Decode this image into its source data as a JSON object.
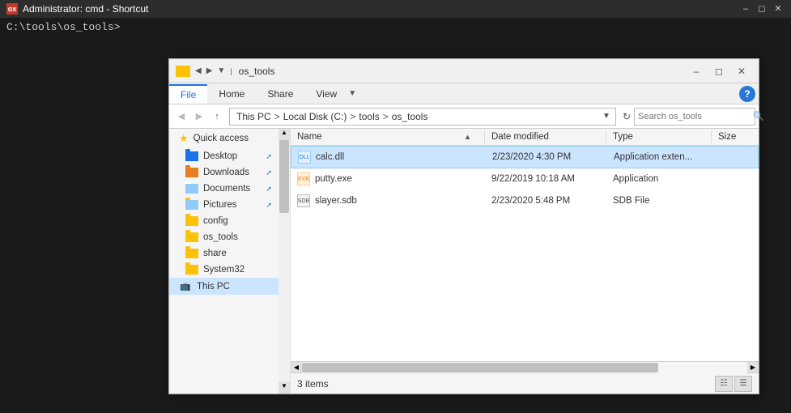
{
  "cmd": {
    "title": "Administrator: cmd - Shortcut",
    "icon_label": "ox",
    "prompt": "C:\\tools\\os_tools>"
  },
  "explorer": {
    "title": "os_tools",
    "ribbon": {
      "tabs": [
        "File",
        "Home",
        "Share",
        "View"
      ],
      "active_tab": "File"
    },
    "address": {
      "breadcrumbs": [
        "This PC",
        "Local Disk (C:)",
        "tools",
        "os_tools"
      ],
      "search_placeholder": "Search os_tools"
    },
    "sidebar": {
      "items": [
        {
          "label": "Quick access",
          "type": "quickaccess",
          "pinned": false
        },
        {
          "label": "Desktop",
          "type": "folder-blue",
          "pinned": true
        },
        {
          "label": "Downloads",
          "type": "folder-download",
          "pinned": true
        },
        {
          "label": "Documents",
          "type": "folder-docs",
          "pinned": true
        },
        {
          "label": "Pictures",
          "type": "folder",
          "pinned": true
        },
        {
          "label": "config",
          "type": "folder"
        },
        {
          "label": "os_tools",
          "type": "folder"
        },
        {
          "label": "share",
          "type": "folder"
        },
        {
          "label": "System32",
          "type": "folder"
        },
        {
          "label": "This PC",
          "type": "computer",
          "active": true
        }
      ]
    },
    "columns": {
      "name": "Name",
      "date_modified": "Date modified",
      "type": "Type",
      "size": "Size"
    },
    "files": [
      {
        "name": "calc.dll",
        "type_icon": "dll",
        "date_modified": "2/23/2020 4:30 PM",
        "file_type": "Application exten...",
        "size": ""
      },
      {
        "name": "putty.exe",
        "type_icon": "exe",
        "date_modified": "9/22/2019 10:18 AM",
        "file_type": "Application",
        "size": ""
      },
      {
        "name": "slayer.sdb",
        "type_icon": "sdb",
        "date_modified": "2/23/2020 5:48 PM",
        "file_type": "SDB File",
        "size": ""
      }
    ],
    "statusbar": {
      "count_label": "3 items"
    }
  }
}
